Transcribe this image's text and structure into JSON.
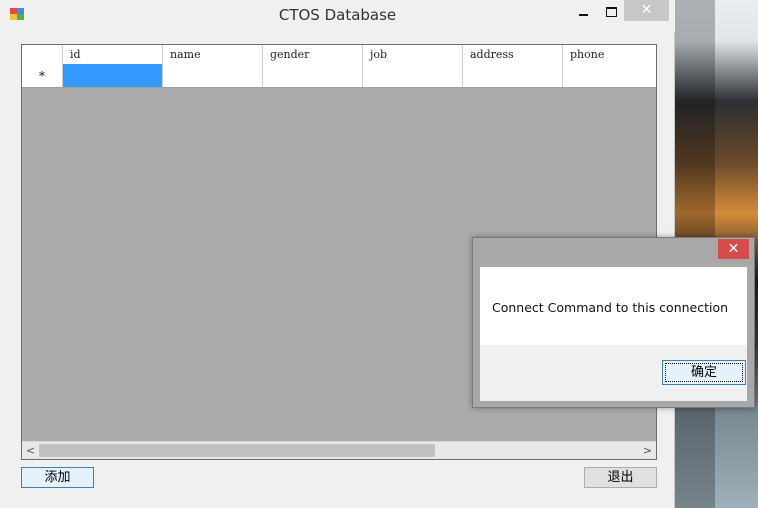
{
  "window": {
    "title": "CTOS Database",
    "controls": {
      "minimize": "minimize",
      "maximize": "maximize",
      "close": "✕"
    }
  },
  "grid": {
    "columns": [
      "id",
      "name",
      "gender",
      "job",
      "address",
      "phone"
    ],
    "new_row_marker": "*",
    "scroll_left": "<",
    "scroll_right": ">"
  },
  "buttons": {
    "add": "添加",
    "exit": "退出"
  },
  "dialog": {
    "close": "✕",
    "message": "Connect Command to this connection",
    "ok": "确定"
  },
  "colors": {
    "selection": "#3399ff",
    "grid_background": "#ababab",
    "dialog_close": "#d64b4b"
  }
}
